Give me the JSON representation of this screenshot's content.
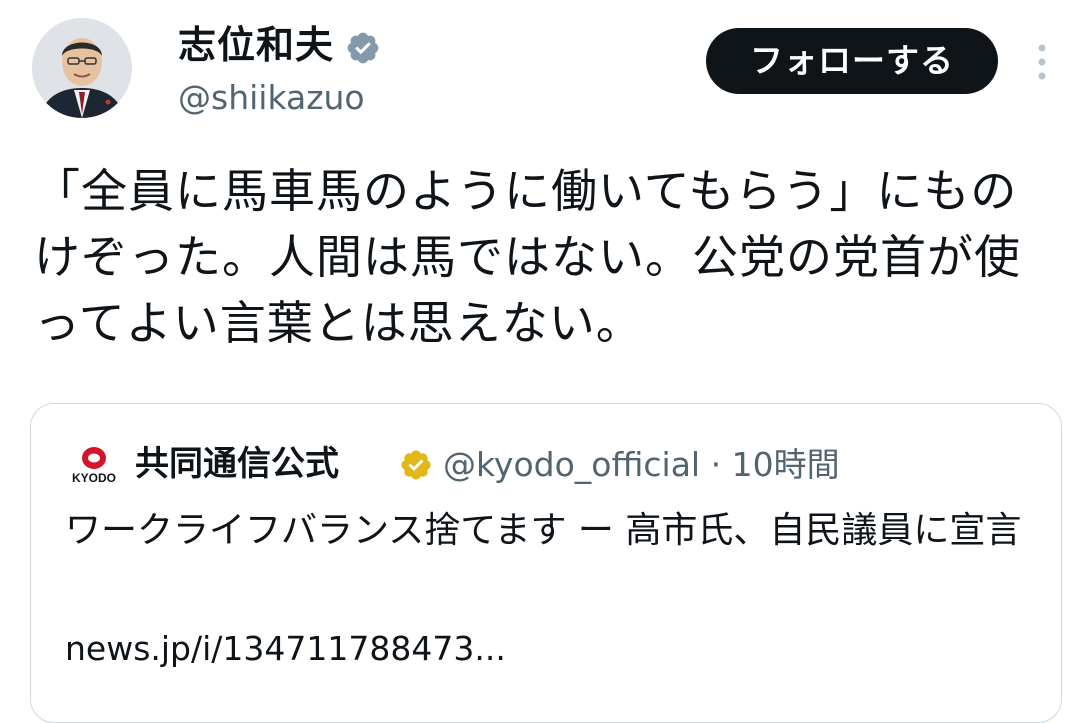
{
  "author": {
    "display_name": "志位和夫",
    "handle": "@shiikazuo",
    "verified_badge": "gray-verified-badge-icon",
    "avatar": "profile-photo"
  },
  "actions": {
    "follow_label": "フォローする",
    "more_icon": "more-vertical-icon"
  },
  "tweet": {
    "text": "「全員に馬車馬のように働いてもらう」にものけぞった。人間は馬ではない。公党の党首が使ってよい言葉とは思えない。"
  },
  "quoted_tweet": {
    "logo": "kyodo-logo-icon",
    "logo_text": "KYODO",
    "display_name": "共同通信公式",
    "verified_badge": "gold-verified-badge-icon",
    "handle": "@kyodo_official",
    "separator": " · ",
    "time": "10時間",
    "text": "ワークライフバランス捨てます ー 高市氏、自民議員に宣言",
    "link": "news.jp/i/134711788473..."
  },
  "colors": {
    "text_primary": "#0f1419",
    "text_secondary": "#536471",
    "follow_button_bg": "#0f1419",
    "follow_button_text": "#ffffff",
    "card_border": "#cfd9de",
    "gold_badge": "#e2b719",
    "gray_badge": "#829aab",
    "kyodo_red": "#d2152a"
  }
}
